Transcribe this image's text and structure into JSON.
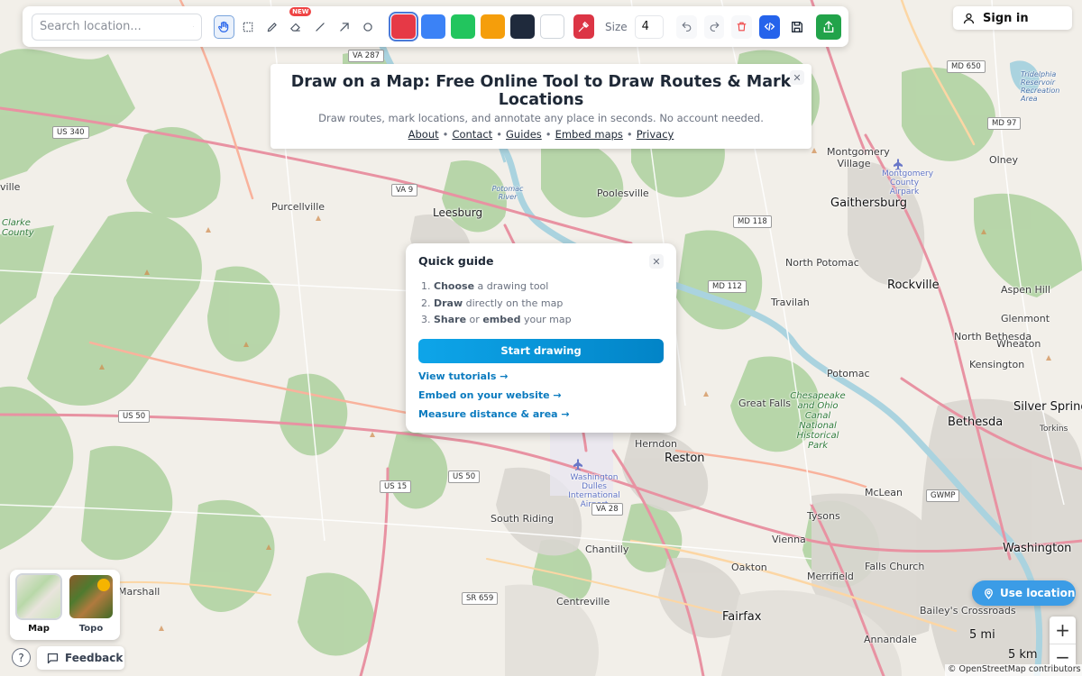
{
  "search": {
    "placeholder": "Search location..."
  },
  "toolbar": {
    "new_badge": "NEW",
    "colors": [
      "#e63946",
      "#3b82f6",
      "#22c55e",
      "#f59e0b",
      "#1f2a3c",
      "#ffffff"
    ],
    "size_label": "Size",
    "size_value": "4"
  },
  "signin": {
    "label": "Sign in"
  },
  "title_card": {
    "title": "Draw on a Map: Free Online Tool to Draw Routes & Mark Locations",
    "subtitle": "Draw routes, mark locations, and annotate any place in seconds. No account needed.",
    "links": [
      "About",
      "Contact",
      "Guides",
      "Embed maps",
      "Privacy"
    ]
  },
  "guide": {
    "title": "Quick guide",
    "steps": [
      {
        "num": "1.",
        "bold": "Choose",
        "rest": " a drawing tool"
      },
      {
        "num": "2.",
        "bold": "Draw",
        "rest": " directly on the map"
      },
      {
        "num": "3.",
        "bold": "Share",
        "mid": " or ",
        "bold2": "embed",
        "rest": " your map"
      }
    ],
    "start_button": "Start drawing",
    "links": [
      "View tutorials →",
      "Embed on your website →",
      "Measure distance & area →"
    ]
  },
  "layers": [
    {
      "label": "Map",
      "active": true
    },
    {
      "label": "Topo",
      "active": false
    }
  ],
  "feedback": {
    "label": "Feedback"
  },
  "use_location": {
    "label": "Use location"
  },
  "scale": {
    "miles": "5 mi",
    "km": "5 km"
  },
  "attribution": {
    "text": "© OpenStreetMap contributors"
  },
  "map_labels": {
    "towns": [
      "Leesburg",
      "Purcellville",
      "Poolesville",
      "Gaithersburg",
      "Rockville",
      "North Potomac",
      "Travilah",
      "Potomac",
      "Great Falls",
      "Reston",
      "Herndon",
      "Bethesda",
      "McLean",
      "Tysons",
      "Vienna",
      "Oakton",
      "Fairfax",
      "Merrifield",
      "Falls Church",
      "Washington",
      "Centreville",
      "Chantilly",
      "South Riding",
      "Marshall",
      "Annandale",
      "Silver Spring",
      "Wheaton",
      "Kensington",
      "Glenmont",
      "Aspen Hill",
      "North Bethesda",
      "Olney",
      "Montgomery Village",
      "Bailey's Crossroads",
      "Clarke County",
      "Tridelphia Reservoir Recreation Area",
      "Montgomery County Airpark",
      "Washington Dulles International Airport",
      "Chesapeake and Ohio Canal National Historical Park",
      "Potomac River",
      "ville",
      "Torkins"
    ],
    "shields": [
      "VA 287",
      "US 340",
      "VA 9",
      "US 15",
      "US 50",
      "US 50",
      "VA 28",
      "SR 659",
      "MD 118",
      "MD 112",
      "MD 650",
      "MD 97",
      "GWMP"
    ]
  }
}
